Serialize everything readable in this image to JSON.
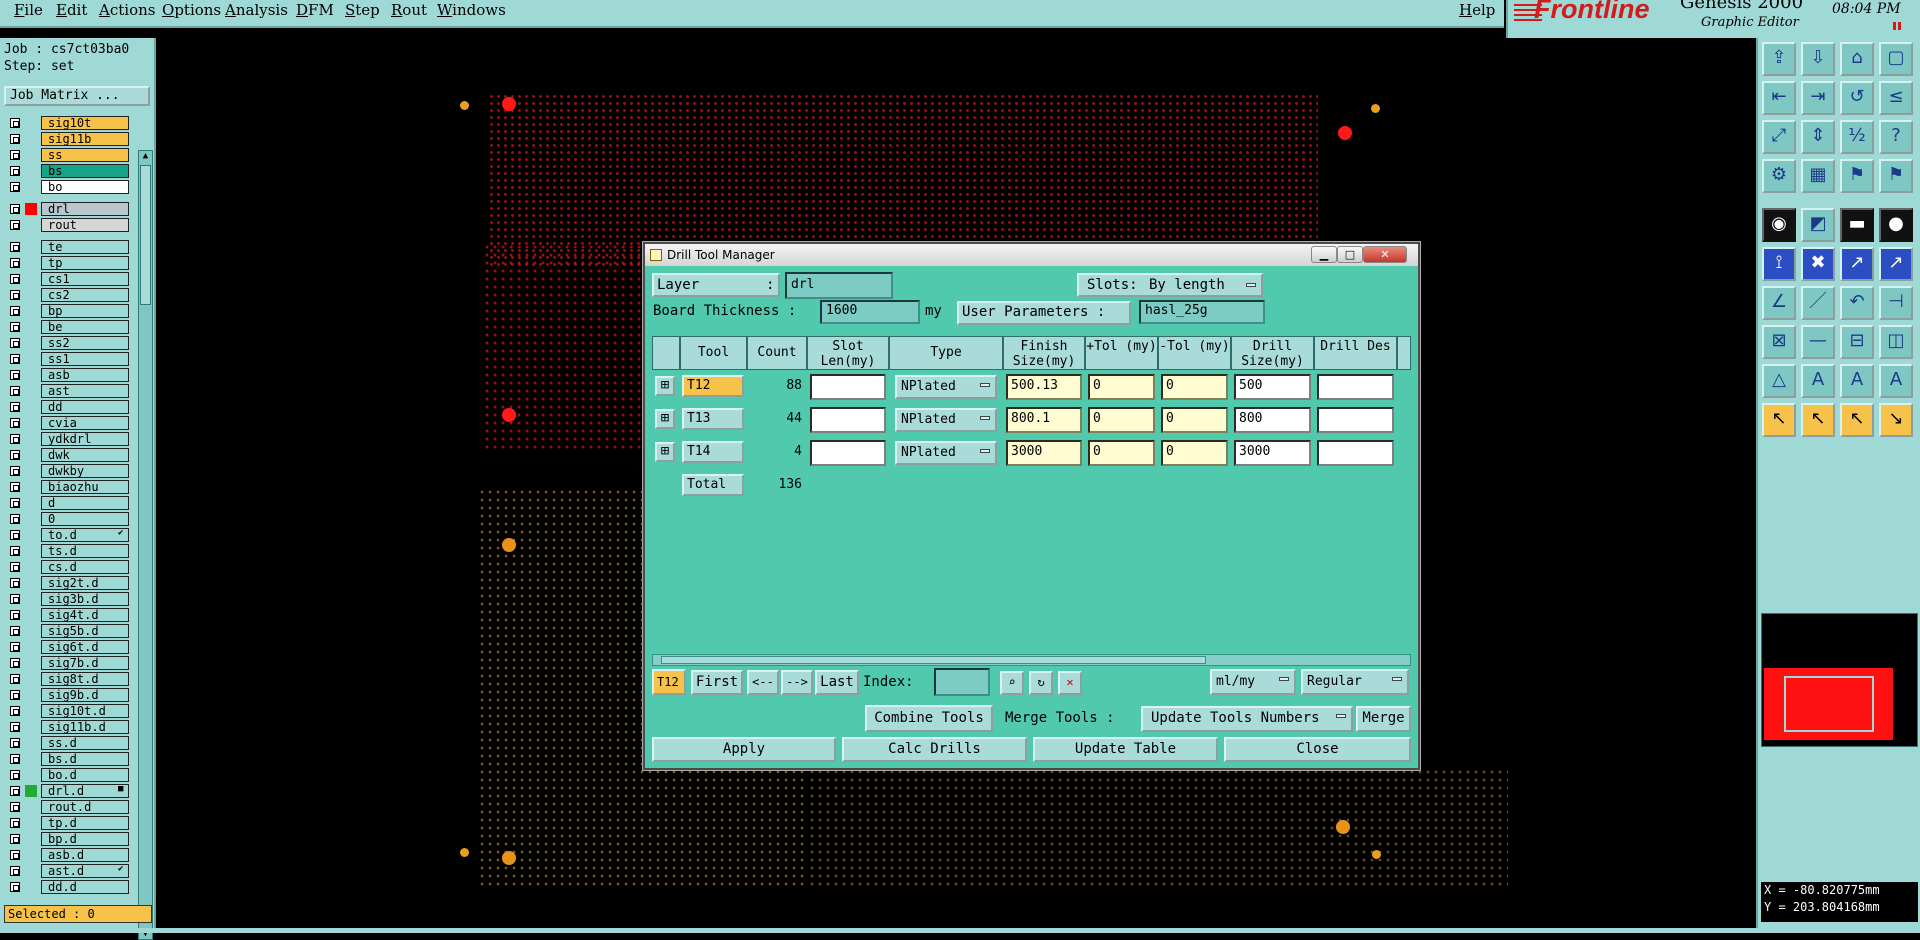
{
  "menubar": {
    "items": [
      "File",
      "Edit",
      "Actions",
      "Options",
      "Analysis",
      "DFM",
      "Step",
      "Rout",
      "Windows"
    ],
    "help": "Help"
  },
  "logo": {
    "brand": "Frontline",
    "product": "Genesis 2000",
    "subtitle": "Graphic Editor",
    "time": "08:04 PM"
  },
  "left_panel": {
    "job_label": "Job : cs7ct03ba0",
    "step_label": "Step: set",
    "job_matrix_button": "Job Matrix ...",
    "layers": [
      {
        "name": "sig10t",
        "color": "#f7c24a"
      },
      {
        "name": "sig11b",
        "color": "#f7c24a"
      },
      {
        "name": "ss",
        "color": "#f7c24a"
      },
      {
        "name": "bs",
        "color": "#1aa386"
      },
      {
        "name": "bo",
        "color": "#ffffff"
      },
      {
        "name": "drl",
        "color": "#b9c6cc",
        "mark": "#ff0000"
      },
      {
        "name": "rout",
        "color": "#d6d6d6"
      },
      {
        "name": "te",
        "color": "#9fd9d6"
      },
      {
        "name": "tp",
        "color": "#9fd9d6"
      },
      {
        "name": "cs1",
        "color": "#9fd9d6"
      },
      {
        "name": "cs2",
        "color": "#9fd9d6"
      },
      {
        "name": "bp",
        "color": "#9fd9d6"
      },
      {
        "name": "be",
        "color": "#9fd9d6"
      },
      {
        "name": "ss2",
        "color": "#9fd9d6"
      },
      {
        "name": "ss1",
        "color": "#9fd9d6"
      },
      {
        "name": "asb",
        "color": "#9fd9d6"
      },
      {
        "name": "ast",
        "color": "#9fd9d6"
      },
      {
        "name": "dd",
        "color": "#9fd9d6"
      },
      {
        "name": "cvia",
        "color": "#9fd9d6"
      },
      {
        "name": "ydkdrl",
        "color": "#9fd9d6"
      },
      {
        "name": "dwk",
        "color": "#9fd9d6"
      },
      {
        "name": "dwkby",
        "color": "#9fd9d6"
      },
      {
        "name": "biaozhu",
        "color": "#9fd9d6"
      },
      {
        "name": "d",
        "color": "#9fd9d6"
      },
      {
        "name": "0",
        "color": "#9fd9d6"
      },
      {
        "name": "to.d",
        "color": "#9fd9d6",
        "flag": "✔"
      },
      {
        "name": "ts.d",
        "color": "#9fd9d6"
      },
      {
        "name": "cs.d",
        "color": "#9fd9d6"
      },
      {
        "name": "sig2t.d",
        "color": "#9fd9d6"
      },
      {
        "name": "sig3b.d",
        "color": "#9fd9d6"
      },
      {
        "name": "sig4t.d",
        "color": "#9fd9d6"
      },
      {
        "name": "sig5b.d",
        "color": "#9fd9d6"
      },
      {
        "name": "sig6t.d",
        "color": "#9fd9d6"
      },
      {
        "name": "sig7b.d",
        "color": "#9fd9d6"
      },
      {
        "name": "sig8t.d",
        "color": "#9fd9d6"
      },
      {
        "name": "sig9b.d",
        "color": "#9fd9d6"
      },
      {
        "name": "sig10t.d",
        "color": "#9fd9d6"
      },
      {
        "name": "sig11b.d",
        "color": "#9fd9d6"
      },
      {
        "name": "ss.d",
        "color": "#9fd9d6"
      },
      {
        "name": "bs.d",
        "color": "#9fd9d6"
      },
      {
        "name": "bo.d",
        "color": "#9fd9d6"
      },
      {
        "name": "drl.d",
        "color": "#9fd9d6",
        "mark": "#22aa33",
        "flag": "■"
      },
      {
        "name": "rout.d",
        "color": "#9fd9d6"
      },
      {
        "name": "tp.d",
        "color": "#9fd9d6"
      },
      {
        "name": "bp.d",
        "color": "#9fd9d6"
      },
      {
        "name": "asb.d",
        "color": "#9fd9d6"
      },
      {
        "name": "ast.d",
        "color": "#9fd9d6",
        "flag": "✔"
      },
      {
        "name": "dd.d",
        "color": "#9fd9d6"
      }
    ],
    "selected": "Selected : 0"
  },
  "dialog": {
    "title": "Drill Tool Manager",
    "layer_label": "Layer",
    "layer_colon": ":",
    "layer_value": "drl",
    "slots_label": "Slots:",
    "slots_value": "By length",
    "board_thickness_label": "Board Thickness :",
    "board_thickness_value": "1600",
    "board_thickness_unit": "my",
    "user_params_label": "User Parameters :",
    "user_params_value": "hasl_25g",
    "columns": [
      "Tool",
      "Count",
      "Slot Len(my)",
      "Type",
      "Finish Size(my)",
      "+Tol (my)",
      "-Tol (my)",
      "Drill Size(my)",
      "Drill Des"
    ],
    "rows": [
      {
        "tool": "T12",
        "count": "88",
        "slot_len": "",
        "type": "NPlated",
        "finish": "500.13",
        "tol_plus": "0",
        "tol_minus": "0",
        "drill": "500",
        "des": ""
      },
      {
        "tool": "T13",
        "count": "44",
        "slot_len": "",
        "type": "NPlated",
        "finish": "800.1",
        "tol_plus": "0",
        "tol_minus": "0",
        "drill": "800",
        "des": ""
      },
      {
        "tool": "T14",
        "count": "4",
        "slot_len": "",
        "type": "NPlated",
        "finish": "3000",
        "tol_plus": "0",
        "tol_minus": "0",
        "drill": "3000",
        "des": ""
      }
    ],
    "total_label": "Total",
    "total_count": "136",
    "current_tool": "T12",
    "nav": {
      "first": "First",
      "prev": "<--",
      "next": "-->",
      "last": "Last",
      "index_label": "Index:",
      "index_value": ""
    },
    "units_value": "ml/my",
    "mode_value": "Regular",
    "combine_tools": "Combine Tools",
    "merge_tools_label": "Merge Tools :",
    "merge_tools_value": "Update Tools Numbers",
    "merge_button": "Merge",
    "apply": "Apply",
    "calc_drills": "Calc Drills",
    "update_table": "Update Table",
    "close": "Close"
  },
  "status": {
    "x": "X = -80.820775mm",
    "y": "Y = 203.804168mm"
  }
}
